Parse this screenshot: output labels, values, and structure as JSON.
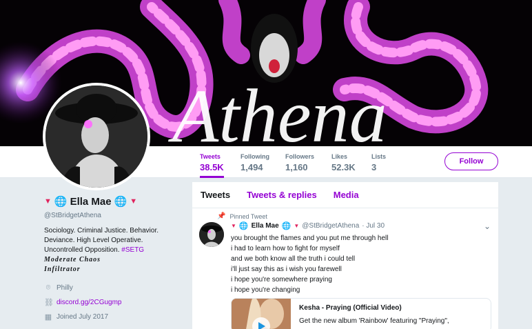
{
  "banner": {
    "text": "Athena"
  },
  "nav": {
    "stats": [
      {
        "label": "Tweets",
        "value": "38.5K"
      },
      {
        "label": "Following",
        "value": "1,494"
      },
      {
        "label": "Followers",
        "value": "1,160"
      },
      {
        "label": "Likes",
        "value": "52.3K"
      },
      {
        "label": "Lists",
        "value": "3"
      }
    ],
    "follow_label": "Follow"
  },
  "profile": {
    "name": "Ella Mae",
    "handle": "@StBridgetAthena",
    "bio_line1": "Sociology. Criminal Justice. Behavior.",
    "bio_line2": "Deviance. High Level Operative.",
    "bio_line3": "Uncontrolled Opposition.",
    "bio_tag": "#SETG",
    "bio_deco1": "Moderate Chaos",
    "bio_deco2": "Infiltrator",
    "location": "Philly",
    "link": "discord.gg/2CGugmp",
    "joined": "Joined July 2017"
  },
  "timeline": {
    "tabs": [
      "Tweets",
      "Tweets & replies",
      "Media"
    ],
    "pinned_label": "Pinned Tweet",
    "tweet": {
      "name": "Ella Mae",
      "handle": "@StBridgetAthena",
      "date": "· Jul 30",
      "lines": [
        "you brought the flames and you put me through hell",
        "i had to learn how to fight for myself",
        "and we both know all the truth i could tell",
        "i'll just say this as i wish you farewell",
        "i hope you're somewhere praying",
        "i hope you're changing"
      ],
      "card": {
        "title": "Kesha - Praying (Official Video)",
        "desc": "Get the new album 'Rainbow' featuring \"Praying\","
      }
    }
  },
  "colors": {
    "accent": "#9400d3",
    "glow": "#e83cf0"
  }
}
